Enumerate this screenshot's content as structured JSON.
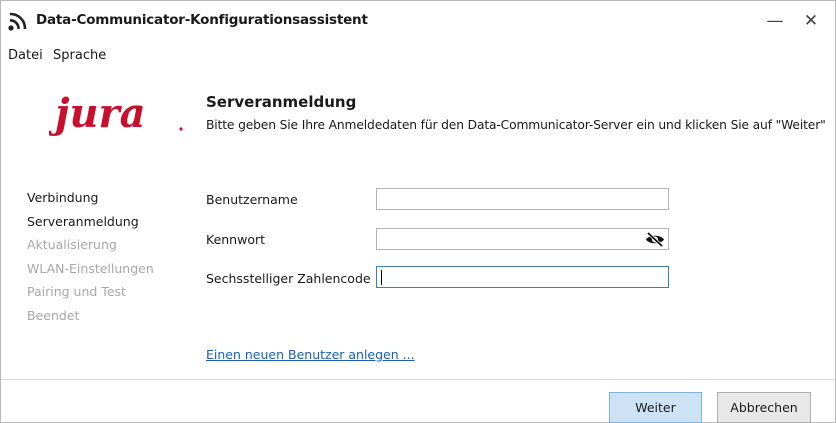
{
  "window": {
    "title": "Data-Communicator-Konfigurationsassistent",
    "app_icon": "wifi-signal-icon",
    "minimize_glyph": "—",
    "close_glyph": "✕"
  },
  "menu": {
    "items": [
      "Datei",
      "Sprache"
    ]
  },
  "brand": {
    "logo_text": "jura",
    "logo_color": "#c8102e"
  },
  "panel": {
    "title": "Serveranmeldung",
    "subtitle": "Bitte geben Sie Ihre Anmeldedaten für den Data-Communicator-Server ein und klicken Sie auf \"Weiter\""
  },
  "steps": [
    {
      "label": "Verbindung",
      "state": "done"
    },
    {
      "label": "Serveranmeldung",
      "state": "current"
    },
    {
      "label": "Aktualisierung",
      "state": "pending"
    },
    {
      "label": "WLAN-Einstellungen",
      "state": "pending"
    },
    {
      "label": "Pairing und Test",
      "state": "pending"
    },
    {
      "label": "Beendet",
      "state": "pending"
    }
  ],
  "form": {
    "username_label": "Benutzername",
    "username_value": "",
    "password_label": "Kennwort",
    "password_value": "",
    "password_toggle_icon": "eye-slash-icon",
    "code_label": "Sechsstelliger Zahlencode",
    "code_value": ""
  },
  "link": {
    "create_user": "Einen neuen Benutzer anlegen ..."
  },
  "buttons": {
    "next": "Weiter",
    "cancel": "Abbrechen"
  },
  "colors": {
    "accent_border": "#3c7fb1",
    "primary_button_bg": "#cde3f5",
    "link": "#1a5fb4",
    "pending_step": "#a8a8a8"
  }
}
